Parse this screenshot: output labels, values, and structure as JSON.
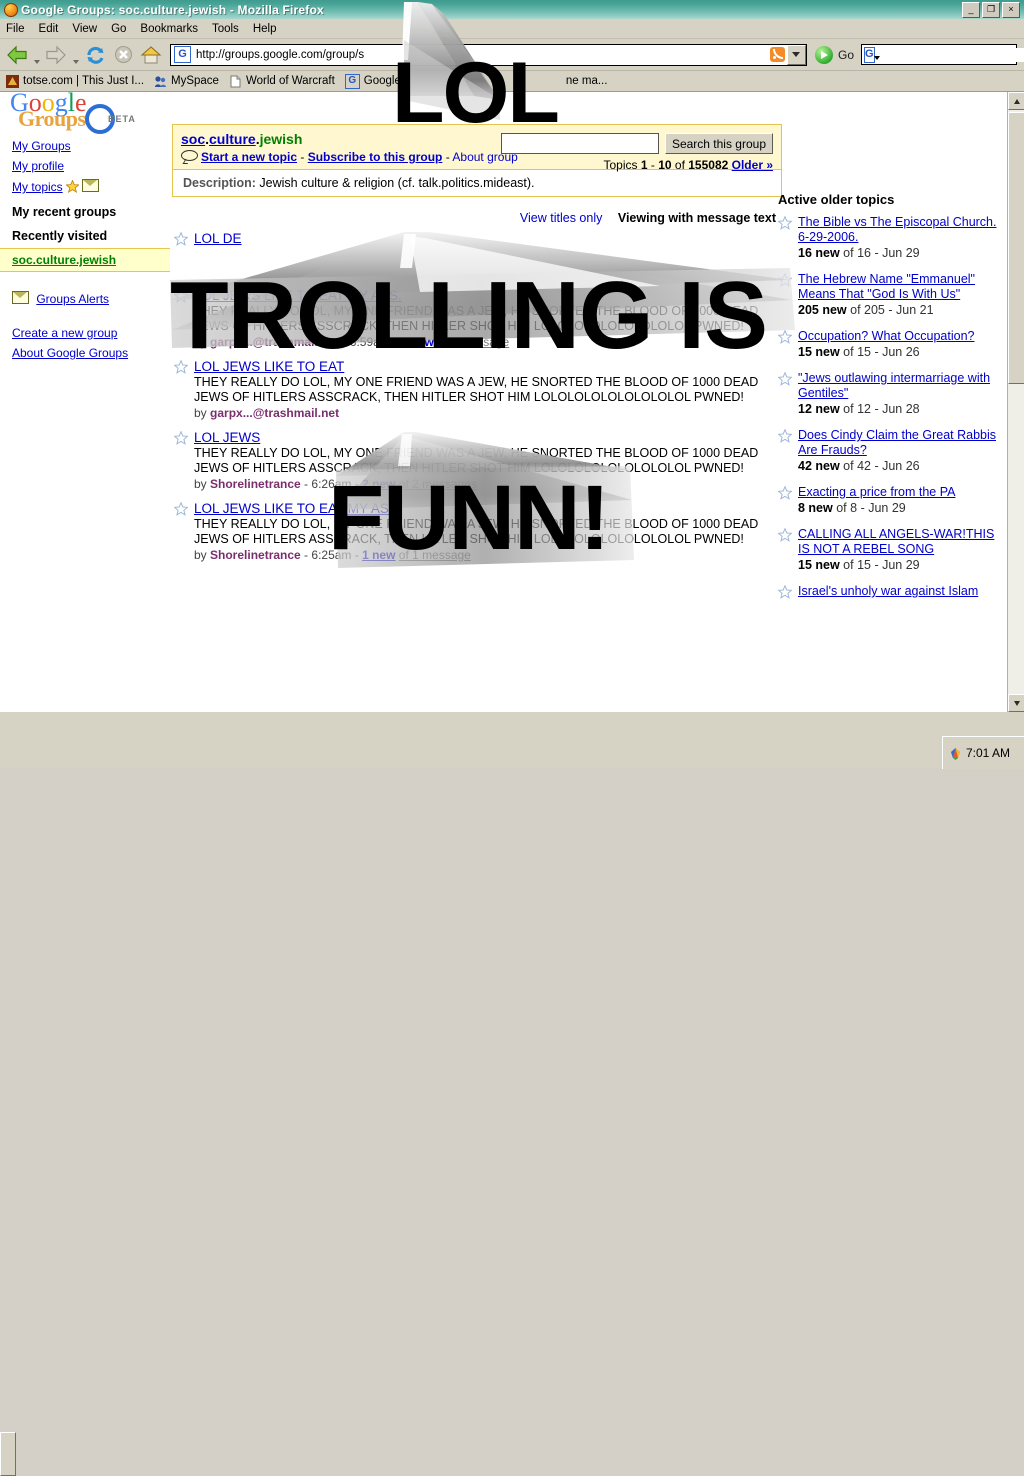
{
  "window": {
    "title": "Google Groups: soc.culture.jewish - Mozilla Firefox",
    "minimize": "_",
    "restore": "❐",
    "close": "×"
  },
  "menubar": {
    "items": [
      "File",
      "Edit",
      "View",
      "Go",
      "Bookmarks",
      "Tools",
      "Help"
    ]
  },
  "toolbar": {
    "back": "back-arrow",
    "forward": "forward-arrow",
    "reload": "reload-icon",
    "stop": "stop-icon",
    "home": "home-icon",
    "url": "http://groups.google.com/group/s",
    "go_label": "Go",
    "search_value": "",
    "favicon_letter": "G"
  },
  "bookmarks": [
    {
      "label": "totse.com | This Just I...",
      "icon": "totse-icon"
    },
    {
      "label": "MySpace",
      "icon": "myspace-icon"
    },
    {
      "label": "World of Warcraft",
      "icon": "page-icon"
    },
    {
      "label": "Google",
      "icon": "google-icon"
    },
    {
      "label": "ne ma...",
      "icon": "page-icon"
    }
  ],
  "branding": {
    "logo_letters": [
      "G",
      "o",
      "o",
      "g",
      "l",
      "e"
    ],
    "product": "Groups",
    "beta": "BETA"
  },
  "sidebar": {
    "links_top": [
      "My Groups",
      "My profile",
      "My topics"
    ],
    "heading_recent_groups": "My recent groups",
    "heading_recently_visited": "Recently visited",
    "current_group": "soc.culture.jewish",
    "alerts": "Groups Alerts",
    "links_bottom": [
      "Create a new group",
      "About Google Groups"
    ]
  },
  "group_header": {
    "part1": "soc",
    "part2": "culture",
    "part3": "jewish",
    "separator": ".",
    "start_topic": "Start a new topic",
    "subscribe": "Subscribe to this group",
    "about": "About group",
    "dash": "-",
    "description_label": "Description:",
    "description": "Jewish culture & religion (cf. talk.politics.mideast).",
    "search_placeholder": "",
    "search_value": "",
    "search_button": "Search this group",
    "topics_prefix": "Topics",
    "topics_range_start": "1",
    "topics_range_end": "10",
    "topics_of": "of",
    "topics_total": "155082",
    "older": "Older »"
  },
  "view_bar": {
    "titles_only": "View titles only",
    "current_view": "Viewing with message text"
  },
  "topics": [
    {
      "title": "LOL DE",
      "body": "",
      "author": "",
      "time": "",
      "new_count": "",
      "of_messages": ""
    },
    {
      "title": "LOL JEWS LIKE TO EAT MY ASS.",
      "body": "THEY REALLY DO LOL, MY ONE FRIEND WAS A JEW, HE SNORTED THE BLOOD OF 1000 DEAD JEWS OF HITLERS ASSCRACK, THEN HITLER SHOT HIM LOLOLOLOLOLOLOLOLOL PWNED!",
      "author": "garpx...@trashmail.net",
      "time": "6:59am",
      "new_count": "1 new",
      "of_messages": "of 1 message"
    },
    {
      "title": "LOL JEWS LIKE TO EAT",
      "body": "THEY REALLY DO LOL, MY ONE FRIEND WAS A JEW, HE SNORTED THE BLOOD OF 1000 DEAD JEWS OF HITLERS ASSCRACK, THEN HITLER SHOT HIM LOLOLOLOLOLOLOLOLOL PWNED!",
      "author": "garpx...@trashmail.net",
      "time": "",
      "new_count": "",
      "of_messages": ""
    },
    {
      "title": "LOL JEWS",
      "body": "THEY REALLY DO LOL, MY ONE FRIEND WAS A JEW, HE SNORTED THE BLOOD OF 1000 DEAD JEWS OF HITLERS ASSCRACK, THEN HITLER SHOT HIM LOLOLOLOLOLOLOLOLOL PWNED!",
      "author": "Shorelinetrance",
      "time": "6:26am",
      "new_count": "2 new",
      "of_messages": "of 2 messages"
    },
    {
      "title": "LOL JEWS LIKE TO EAT MY ASS.",
      "body": "THEY REALLY DO LOL, MY ONE FRIEND WAS A JEW, HE SNORTED THE BLOOD OF 1000 DEAD JEWS OF HITLERS ASSCRACK, THEN HITLER SHOT HIM LOLOLOLOLOLOLOLOLOL PWNED!",
      "author": "Shorelinetrance",
      "time": "6:25am",
      "new_count": "1 new",
      "of_messages": "of 1 message"
    }
  ],
  "active_older": {
    "heading": "Active older topics",
    "items": [
      {
        "title": "The Bible vs The Episcopal Church. 6-29-2006.",
        "new": "16 new",
        "of": "of 16",
        "date": "- Jun 29"
      },
      {
        "title": "The Hebrew Name \"Emmanuel\" Means That \"God Is With Us\"",
        "new": "205 new",
        "of": "of 205",
        "date": "- Jun 21"
      },
      {
        "title": "Occupation? What Occupation?",
        "new": "15 new",
        "of": "of 15",
        "date": "- Jun 26"
      },
      {
        "title": "\"Jews outlawing intermarriage with Gentiles\"",
        "new": "12 new",
        "of": "of 12",
        "date": "- Jun 28"
      },
      {
        "title": "Does Cindy Claim the Great Rabbis Are Frauds?",
        "new": "42 new",
        "of": "of 42",
        "date": "- Jun 26"
      },
      {
        "title": "Exacting a price from the PA",
        "new": "8 new",
        "of": "of 8",
        "date": "- Jun 29"
      },
      {
        "title": "CALLING ALL ANGELS-WAR!THIS IS NOT A REBEL SONG",
        "new": "15 new",
        "of": "of 15",
        "date": "- Jun 29"
      },
      {
        "title": "Israel's unholy war against Islam",
        "new": "",
        "of": "",
        "date": ""
      }
    ]
  },
  "overlay": {
    "line1": "LOL",
    "line2": "TROLLING IS",
    "line3": "FUNN!"
  },
  "taskbar": {
    "clock": "7:01 AM"
  },
  "colors": {
    "titlebar": "#47a396",
    "chrome": "#d6d2c4",
    "group_header_bg": "#fff7d0",
    "group_header_border": "#e2c44e",
    "link": "#0000cc",
    "author": "#7a2e6e",
    "group_green": "#008000",
    "highlight": "#ffffcc"
  }
}
